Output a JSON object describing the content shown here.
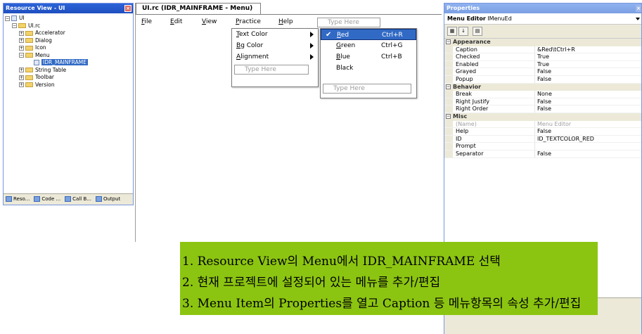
{
  "resource_view": {
    "title": "Resource View - UI",
    "tree": [
      {
        "label": "UI",
        "level": 0,
        "expander": "−",
        "icon": "project-icon"
      },
      {
        "label": "UI.rc",
        "level": 1,
        "expander": "−",
        "icon": "folder-icon"
      },
      {
        "label": "Accelerator",
        "level": 2,
        "expander": "+",
        "icon": "folder-icon"
      },
      {
        "label": "Dialog",
        "level": 2,
        "expander": "+",
        "icon": "folder-icon"
      },
      {
        "label": "Icon",
        "level": 2,
        "expander": "+",
        "icon": "folder-icon"
      },
      {
        "label": "Menu",
        "level": 2,
        "expander": "−",
        "icon": "folder-icon"
      },
      {
        "label": "IDR_MAINFRAME",
        "level": 3,
        "expander": "",
        "icon": "menu-resource-icon",
        "selected": true
      },
      {
        "label": "String Table",
        "level": 2,
        "expander": "+",
        "icon": "folder-icon"
      },
      {
        "label": "Toolbar",
        "level": 2,
        "expander": "+",
        "icon": "folder-icon"
      },
      {
        "label": "Version",
        "level": 2,
        "expander": "+",
        "icon": "folder-icon"
      }
    ],
    "tabs": [
      "Reso...",
      "Code ...",
      "Call B...",
      "Output"
    ]
  },
  "editor": {
    "tab_title": "UI.rc (IDR_MAINFRAME - Menu)",
    "menubar": [
      "File",
      "Edit",
      "View",
      "Practice",
      "Help"
    ],
    "menubar_type_here": "Type Here",
    "practice_menu": {
      "items": [
        "Text Color",
        "Bg Color",
        "Alignment"
      ],
      "type_here": "Type Here"
    },
    "text_color_menu": {
      "items": [
        {
          "label": "Red",
          "accel": "Ctrl+R",
          "checked": true,
          "highlighted": true
        },
        {
          "label": "Green",
          "accel": "Ctrl+G"
        },
        {
          "label": "Blue",
          "accel": "Ctrl+B"
        },
        {
          "label": "Black",
          "accel": ""
        }
      ],
      "type_here": "Type Here"
    }
  },
  "properties": {
    "title": "Properties",
    "object": "Menu Editor",
    "object_type": "IMenuEd",
    "groups": [
      {
        "name": "Appearance",
        "rows": [
          {
            "name": "Caption",
            "value": "&Red\\tCtrl+R"
          },
          {
            "name": "Checked",
            "value": "True"
          },
          {
            "name": "Enabled",
            "value": "True"
          },
          {
            "name": "Grayed",
            "value": "False"
          },
          {
            "name": "Popup",
            "value": "False"
          }
        ]
      },
      {
        "name": "Behavior",
        "rows": [
          {
            "name": "Break",
            "value": "None"
          },
          {
            "name": "Right Justify",
            "value": "False"
          },
          {
            "name": "Right Order",
            "value": "False"
          }
        ]
      },
      {
        "name": "Misc",
        "rows": [
          {
            "name": "(Name)",
            "value": "Menu Editor",
            "dim": true
          },
          {
            "name": "Help",
            "value": "False"
          },
          {
            "name": "ID",
            "value": "ID_TEXTCOLOR_RED"
          },
          {
            "name": "Prompt",
            "value": ""
          },
          {
            "name": "Separator",
            "value": "False"
          }
        ]
      }
    ]
  },
  "annotation": {
    "lines": [
      "1. Resource View의 Menu에서 IDR_MAINFRAME 선택",
      "2. 현재 프로젝트에 설정되어 있는 메뉴를 추가/편집",
      "3. Menu Item의 Properties를 열고 Caption 등 메뉴항목의 속성 추가/편집"
    ]
  },
  "colors": {
    "highlight": "#316ac5",
    "annotation_bg": "#8cc511",
    "titlebar_active": "#2b63d8"
  }
}
